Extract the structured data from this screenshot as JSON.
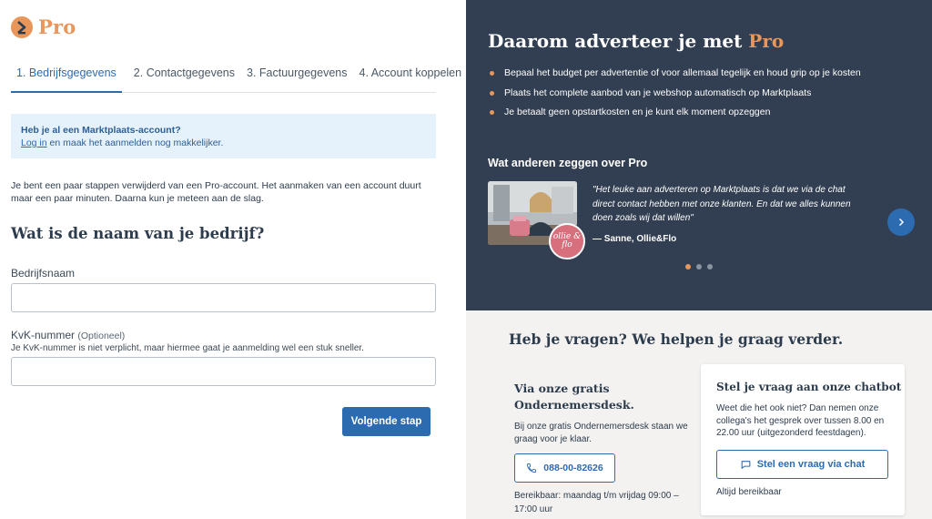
{
  "logo": {
    "text": "Pro"
  },
  "tabs": [
    {
      "label": "1. Bedrijfsgegevens"
    },
    {
      "label": "2. Contactgegevens"
    },
    {
      "label": "3. Factuurgegevens"
    },
    {
      "label": "4. Account koppelen"
    }
  ],
  "info": {
    "title": "Heb je al een Marktplaats-account?",
    "link": "Log in",
    "rest": " en maak het aanmelden nog makkelijker."
  },
  "intro": "Je bent een paar stappen verwijderd van een Pro-account. Het aanmaken van een account duurt maar een paar minuten. Daarna kun je meteen aan de slag.",
  "form": {
    "question": "Wat is de naam van je bedrijf?",
    "company_label": "Bedrijfsnaam",
    "kvk_label": "KvK-nummer",
    "kvk_optional": "(Optioneel)",
    "kvk_hint": "Je KvK-nummer is niet verplicht, maar hiermee gaat je aanmelding wel een stuk sneller.",
    "next_label": "Volgende stap"
  },
  "promo": {
    "title_prefix": "Daarom adverteer je met ",
    "title_accent": "Pro",
    "bullets": [
      "Bepaal het budget per advertentie of voor allemaal tegelijk en houd grip op je kosten",
      "Plaats het complete aanbod van je webshop automatisch op Marktplaats",
      "Je betaalt geen opstartkosten en je kunt elk moment opzeggen"
    ],
    "testimonials_title": "Wat anderen zeggen over Pro",
    "badge_text": "ollie & flo",
    "quote": "\"Het leuke aan adverteren op Marktplaats is dat we via de chat direct contact hebben met onze klanten. En dat we alles kunnen doen zoals wij dat willen\"",
    "author": "— Sanne, Ollie&Flo"
  },
  "help": {
    "title": "Heb je vragen? We helpen je graag verder.",
    "desk_title": "Via onze gratis Ondernemersdesk.",
    "desk_text": "Bij onze gratis Ondernemersdesk staan we graag voor je klaar.",
    "phone": "088-00-82626",
    "reach": "Bereikbaar: maandag t/m vrijdag 09:00 – 17:00 uur",
    "chat_title": "Stel je vraag aan onze chatbot",
    "chat_text": "Weet die het ook niet? Dan nemen onze collega's het gesprek over tussen 8.00 en 22.00 uur (uitgezonderd feestdagen).",
    "chat_button": "Stel een vraag via chat",
    "chat_avail": "Altijd bereikbaar"
  },
  "colors": {
    "accent": "#e8965a",
    "primary": "#2d6bb0",
    "dark_panel": "#323e51",
    "info_bg": "#e5f1fb"
  }
}
